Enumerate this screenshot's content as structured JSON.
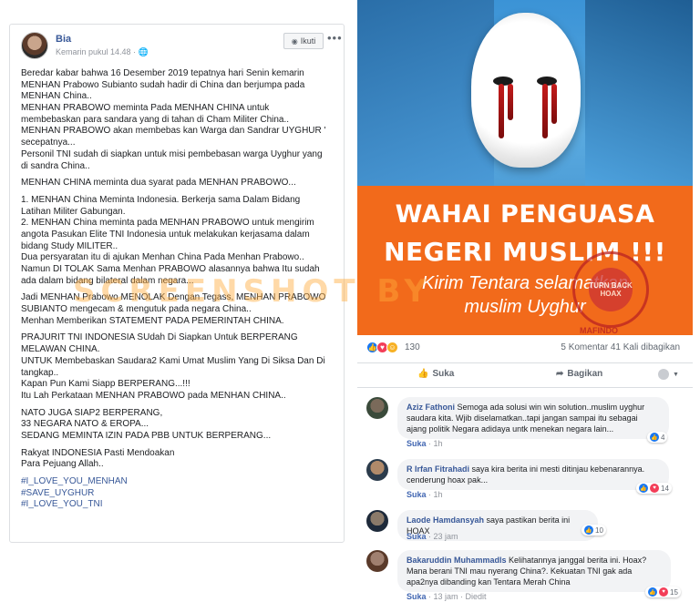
{
  "post": {
    "author": "Bia",
    "timestamp": "Kemarin pukul 14.48 · ",
    "follow_label": "Ikuti",
    "more": "•••",
    "lines": [
      "Beredar kabar bahwa 16 Desember 2019 tepatnya hari Senin kemarin",
      "MENHAN Prabowo Subianto sudah hadir di China dan berjumpa pada",
      "MENHAN China..",
      "MENHAN PRABOWO meminta Pada MENHAN CHINA untuk",
      "membebaskan para sandara yang di tahan di Cham Militer China..",
      "MENHAN PRABOWO akan membebas kan Warga dan Sandrar UYGHUR '",
      "secepatnya...",
      "Personil TNI sudah di siapkan untuk misi pembebasan warga Uyghur yang",
      "di sandra China..",
      "",
      "MENHAN CHINA meminta dua syarat pada MENHAN PRABOWO...",
      "",
      "1. MENHAN China Meminta Indonesia. Berkerja sama Dalam Bidang",
      "Latihan Militer Gabungan.",
      "2. MENHAN China meminta pada MENHAN PRABOWO untuk mengirim",
      "angota Pasukan Elite TNI Indonesia untuk melakukan kerjasama dalam",
      "bidang Study MILITER..",
      "Dua persyaratan itu di ajukan Menhan China Pada Menhan Prabowo..",
      "Namun DI TOLAK Sama Menhan PRABOWO alasannya bahwa Itu sudah",
      "ada dalam bidang bilateral dalam negara...",
      "",
      "Jadi MENHAN Prabowo MENOLAK Dengan Tegass, MENHAN PRABOWO",
      "SUBIANTO mengecam & mengutuk pada negara China..",
      "Menhan Memberikan STATEMENT PADA PEMERINTAH CHINA.",
      "",
      "PRAJURIT TNI INDONESIA SUdah Di Siapkan Untuk BERPERANG",
      "MELAWAN CHINA.",
      "UNTUK Membebaskan Saudara2 Kami Umat Muslim Yang Di Siksa Dan Di",
      "tangkap..",
      "Kapan Pun Kami Siapp BERPERANG...!!!",
      "Itu Lah Perkataan MENHAN PRABOWO pada MENHAN CHINA..",
      "",
      "NATO JUGA SIAP2 BERPERANG,",
      "33 NEGARA NATO & EROPA...",
      "SEDANG MEMINTA IZIN PADA PBB UNTUK BERPERANG...",
      "",
      "Rakyat INDONESIA Pasti Mendoakan",
      "Para Pejuang Allah.."
    ],
    "hashtags": [
      "#I_LOVE_YOU_MENHAN",
      "#SAVE_UYGHUR",
      "#I_LOVE_YOU_TNI"
    ]
  },
  "image": {
    "banner_line1": "WAHAI PENGUASA",
    "banner_line2": "NEGERI MUSLIM !!!",
    "banner_line3": "Kirim Tentara selamatkan",
    "banner_line4": "muslim Uyghur",
    "stamp_text": "TURN BACK HOAX",
    "stamp_bottom": "MAFINDO"
  },
  "watermark": "SCREENSHOT BY",
  "stats": {
    "reaction_count": "130",
    "shares": "5 Komentar  41 Kali dibagikan"
  },
  "actions": {
    "like": "Suka",
    "share": "Bagikan"
  },
  "comments": [
    {
      "name": "Aziz Fathoni",
      "text1": " Semoga ada solusi win win solution..muslim uyghur",
      "text2": "saudara kita. Wjib diselamatkan..tapi jangan sampai itu sebagai",
      "text3": "ajang politik Negara adidaya untk menekan negara lain...",
      "like": "Suka",
      "time": "1h",
      "reactions": "4"
    },
    {
      "name": "R Irfan Fitrahadi",
      "text1": " saya kira berita ini mesti ditinjau kebenarannya.",
      "text2": "cenderung hoax pak...",
      "like": "Suka",
      "time": "1h",
      "reactions": "14"
    },
    {
      "name": "Laode Hamdansyah",
      "text1": " saya pastikan berita ini HOAX",
      "like": "Suka",
      "time": "23 jam",
      "reactions": "10"
    },
    {
      "name": "Bakaruddin Muhammadls",
      "text1": " Kelihatannya janggal berita ini. Hoax?",
      "text2": "Mana berani TNI mau nyerang China?. Kekuatan TNI gak ada",
      "text3": "apa2nya dibanding kan Tentara Merah China",
      "like": "Suka",
      "time": "13 jam",
      "edited": "Diedit",
      "reactions": "15"
    }
  ],
  "colors": {
    "link": "#385898",
    "banner": "#f26a1b",
    "like_blue": "#1877f2"
  }
}
